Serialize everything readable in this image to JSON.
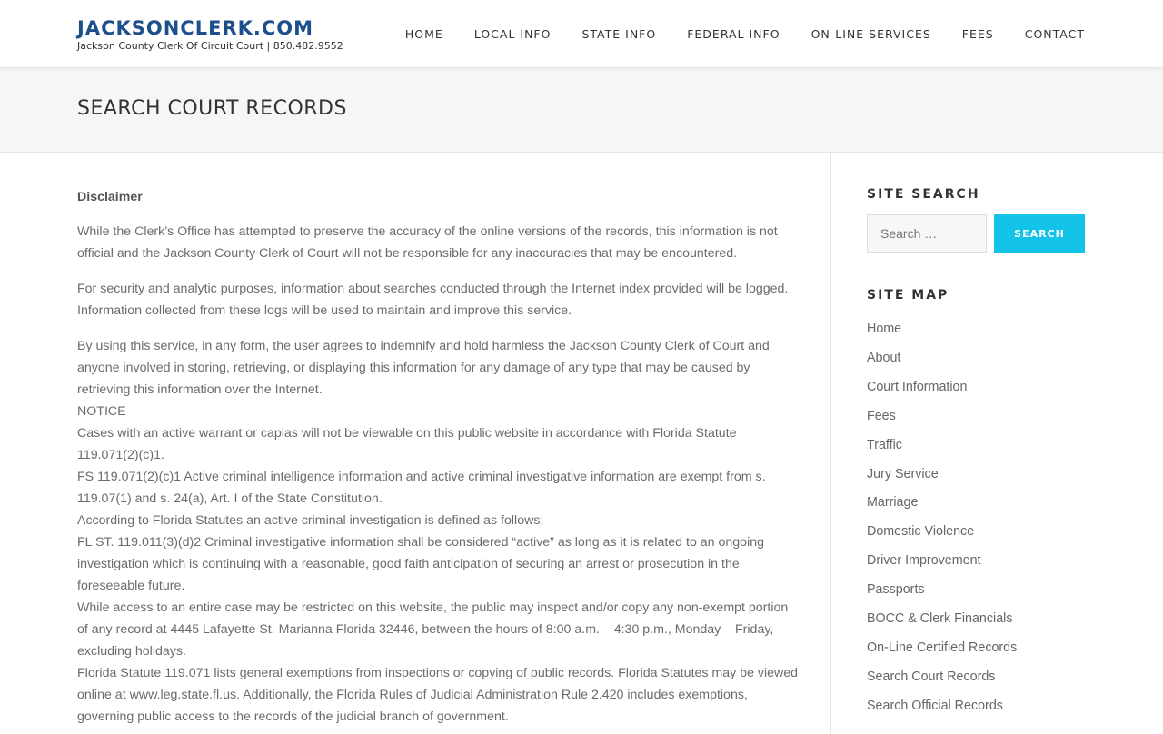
{
  "header": {
    "brand_title": "JACKSONCLERK.COM",
    "brand_subtitle": "Jackson County Clerk Of Circuit Court | 850.482.9552",
    "nav": [
      "HOME",
      "LOCAL INFO",
      "STATE INFO",
      "FEDERAL INFO",
      "ON-LINE SERVICES",
      "FEES",
      "CONTACT"
    ]
  },
  "page": {
    "title": "SEARCH COURT RECORDS"
  },
  "content": {
    "disclaimer_heading": "Disclaimer",
    "paragraphs": [
      "While the Clerk’s Office has attempted to preserve the accuracy of the online versions of the records, this information is not official and the Jackson County Clerk of Court will not be responsible for any inaccuracies that may be encountered.",
      "For security and analytic purposes, information about searches conducted through the Internet index provided will be logged. Information collected from these logs will be used to maintain and improve this service."
    ],
    "notice_lines": [
      "By using this service, in any form, the user agrees to indemnify and hold harmless the Jackson County Clerk of Court and anyone involved in storing, retrieving, or displaying this information for any damage of any type that may be caused by retrieving this information over the Internet.",
      "NOTICE",
      "Cases with an active warrant or capias will not be viewable on this public website in accordance with Florida Statute 119.071(2)(c)1.",
      "FS 119.071(2)(c)1 Active criminal intelligence information and active criminal investigative information are exempt from s. 119.07(1) and s. 24(a), Art. I of the State Constitution.",
      "According to Florida Statutes an active criminal investigation is defined as follows:",
      "FL ST. 119.011(3)(d)2 Criminal investigative information shall be considered “active” as long as it is related to an ongoing investigation which is continuing with a reasonable, good faith anticipation of securing an arrest or prosecution in the foreseeable future.",
      "While access to an entire case may be restricted on this website, the public may inspect and/or copy any non-exempt portion of any record at 4445 Lafayette St. Marianna Florida 32446, between the hours of 8:00 a.m. – 4:30 p.m., Monday – Friday, excluding holidays.",
      "Florida Statute 119.071 lists general exemptions from inspections or copying of public records. Florida Statutes may be viewed online at www.leg.state.fl.us. Additionally, the Florida Rules of Judicial Administration Rule 2.420 includes exemptions, governing public access to the records of the judicial branch of government."
    ]
  },
  "sidebar": {
    "search_title": "SITE SEARCH",
    "search_placeholder": "Search …",
    "search_button": "SEARCH",
    "sitemap_title": "SITE MAP",
    "sitemap": [
      "Home",
      "About",
      "Court Information",
      "Fees",
      "Traffic",
      "Jury Service",
      "Marriage",
      "Domestic Violence",
      "Driver Improvement",
      "Passports",
      "BOCC & Clerk Financials",
      "On-Line Certified Records",
      "Search Court Records",
      "Search Official Records"
    ]
  },
  "colors": {
    "brand": "#1d4f8c",
    "accent": "#13c4e8",
    "band": "#f5f6f5"
  }
}
